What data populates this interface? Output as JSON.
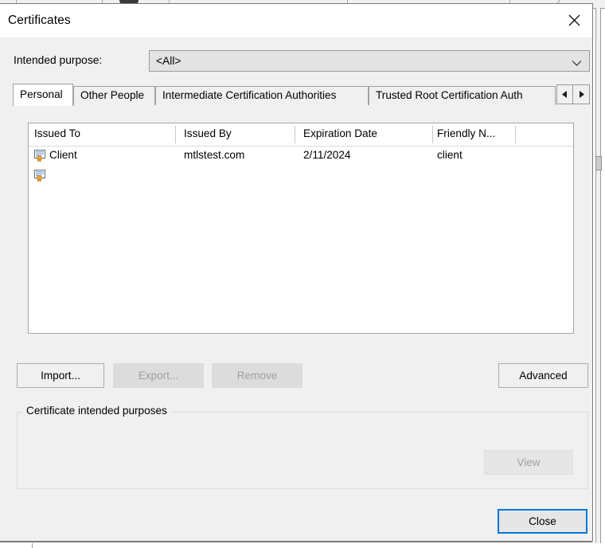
{
  "window": {
    "title": "Certificates",
    "close_icon": "close-x-icon"
  },
  "purpose": {
    "label": "Intended purpose:",
    "selected": "<All>",
    "dropdown_icon": "chevron-down-icon",
    "options": [
      "<All>"
    ]
  },
  "tabs": {
    "items": [
      {
        "label": "Personal",
        "selected": true
      },
      {
        "label": "Other People",
        "selected": false
      },
      {
        "label": "Intermediate Certification Authorities",
        "selected": false
      },
      {
        "label": "Trusted Root Certification Auth",
        "selected": false
      }
    ],
    "scroll_left_icon": "triangle-left-icon",
    "scroll_right_icon": "triangle-right-icon"
  },
  "certificate_list": {
    "columns": [
      "Issued To",
      "Issued By",
      "Expiration Date",
      "Friendly N..."
    ],
    "rows": [
      {
        "icon": "certificate-icon",
        "issued_to": "Client",
        "issued_by": "mtlstest.com",
        "expiration_date": "2/11/2024",
        "friendly_name": "client"
      },
      {
        "icon": "certificate-icon",
        "issued_to": "",
        "issued_by": "",
        "expiration_date": "",
        "friendly_name": ""
      }
    ]
  },
  "actions": {
    "import": "Import...",
    "export": "Export...",
    "remove": "Remove",
    "advanced": "Advanced"
  },
  "purposes_group": {
    "title": "Certificate intended purposes",
    "body_text": "",
    "view_button": "View"
  },
  "footer": {
    "close": "Close"
  },
  "colors": {
    "accent": "#0078d7",
    "dialog_bg": "#f0f0f0",
    "field_bg": "#e3e3e3",
    "list_bg": "#ffffff",
    "disabled_text": "#a0a0a0",
    "cert_seal": "#e8a33d"
  }
}
